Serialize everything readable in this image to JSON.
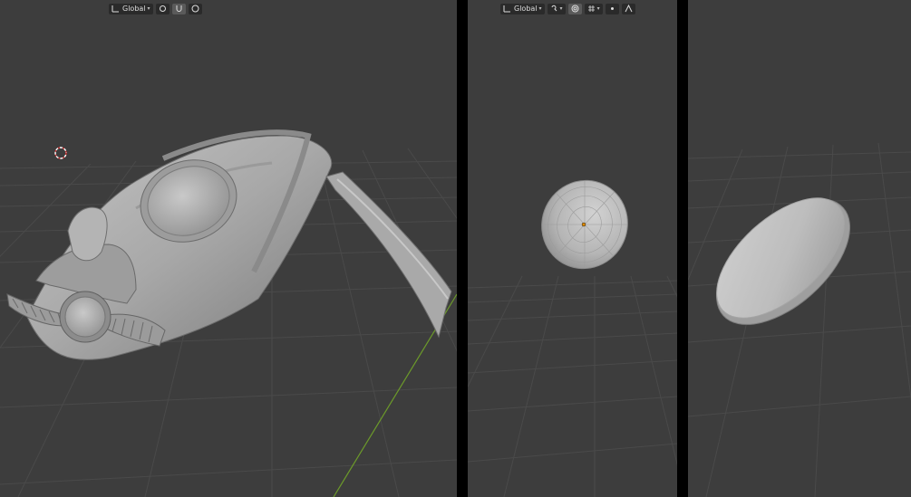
{
  "viewport_left": {
    "header": {
      "shading_label": "Global"
    },
    "object": "scarab-armor-sculpt"
  },
  "viewport_middle": {
    "header": {
      "transform_orientation": "Global",
      "pivot_icon": "pivot-point-icon",
      "snap_icon": "snap-magnet-icon",
      "proportional_icon": "proportional-edit-icon",
      "falloff_icon": "falloff-curve-icon"
    },
    "object": "dome-disc-top-view"
  },
  "viewport_right": {
    "object": "flat-disc-perspective"
  },
  "colors": {
    "background": "#3d3d3d",
    "grid": "#4a4a4a",
    "y_axis": "#6c9a2a",
    "model": "#b0b0b0",
    "origin": "#e08a00",
    "cursor": "#d03030"
  }
}
